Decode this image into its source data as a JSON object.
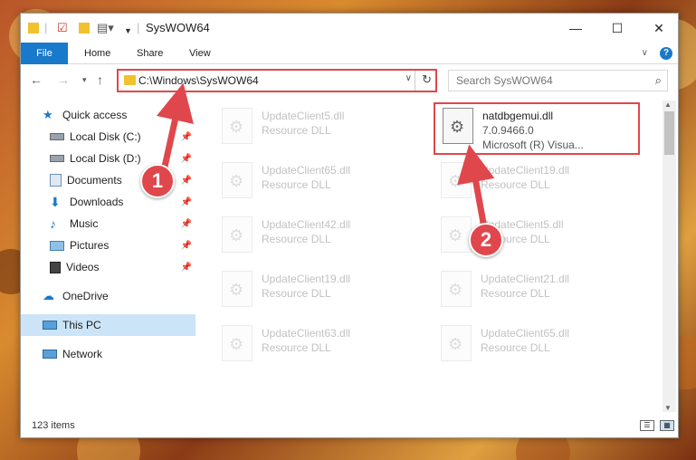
{
  "window": {
    "title": "SysWOW64",
    "controls": {
      "minimize": "—",
      "maximize": "☐",
      "close": "✕"
    }
  },
  "ribbon": {
    "tabs": [
      "File",
      "Home",
      "Share",
      "View"
    ],
    "help": "?"
  },
  "address": {
    "path": "C:\\Windows\\SysWOW64",
    "search_placeholder": "Search SysWOW64"
  },
  "sidebar": {
    "items": [
      {
        "label": "Quick access",
        "icon": "star-icon",
        "pinned": false
      },
      {
        "label": "Local Disk (C:)",
        "icon": "drive-icon",
        "pinned": true
      },
      {
        "label": "Local Disk (D:)",
        "icon": "drive-icon",
        "pinned": true
      },
      {
        "label": "Documents",
        "icon": "documents-icon",
        "pinned": true
      },
      {
        "label": "Downloads",
        "icon": "download-icon",
        "pinned": true
      },
      {
        "label": "Music",
        "icon": "music-icon",
        "pinned": true
      },
      {
        "label": "Pictures",
        "icon": "pictures-icon",
        "pinned": true
      },
      {
        "label": "Videos",
        "icon": "videos-icon",
        "pinned": true
      },
      {
        "label": "OneDrive",
        "icon": "cloud-icon",
        "pinned": false
      },
      {
        "label": "This PC",
        "icon": "pc-icon",
        "pinned": false,
        "selected": true
      },
      {
        "label": "Network",
        "icon": "network-icon",
        "pinned": false
      }
    ]
  },
  "files": [
    {
      "name": "UpdateClient5.dll",
      "sub1": "Resource DLL",
      "sub2": "",
      "faded": true
    },
    {
      "name": "natdbgemui.dll",
      "sub1": "7.0.9466.0",
      "sub2": "Microsoft (R) Visua...",
      "faded": false,
      "highlighted": true
    },
    {
      "name": "UpdateClient65.dll",
      "sub1": "Resource DLL",
      "sub2": "",
      "faded": true
    },
    {
      "name": "UpdateClient19.dll",
      "sub1": "Resource DLL",
      "sub2": "",
      "faded": true
    },
    {
      "name": "UpdateClient42.dll",
      "sub1": "Resource DLL",
      "sub2": "",
      "faded": true
    },
    {
      "name": "UpdateClient5.dll",
      "sub1": "Resource DLL",
      "sub2": "",
      "faded": true
    },
    {
      "name": "UpdateClient19.dll",
      "sub1": "Resource DLL",
      "sub2": "",
      "faded": true
    },
    {
      "name": "UpdateClient21.dll",
      "sub1": "Resource DLL",
      "sub2": "",
      "faded": true
    },
    {
      "name": "UpdateClient63.dll",
      "sub1": "Resource DLL",
      "sub2": "",
      "faded": true
    },
    {
      "name": "UpdateClient65.dll",
      "sub1": "Resource DLL",
      "sub2": "",
      "faded": true
    }
  ],
  "status": {
    "count": "123 items"
  },
  "annotations": {
    "step1": "1",
    "step2": "2",
    "color": "#e0474c"
  }
}
